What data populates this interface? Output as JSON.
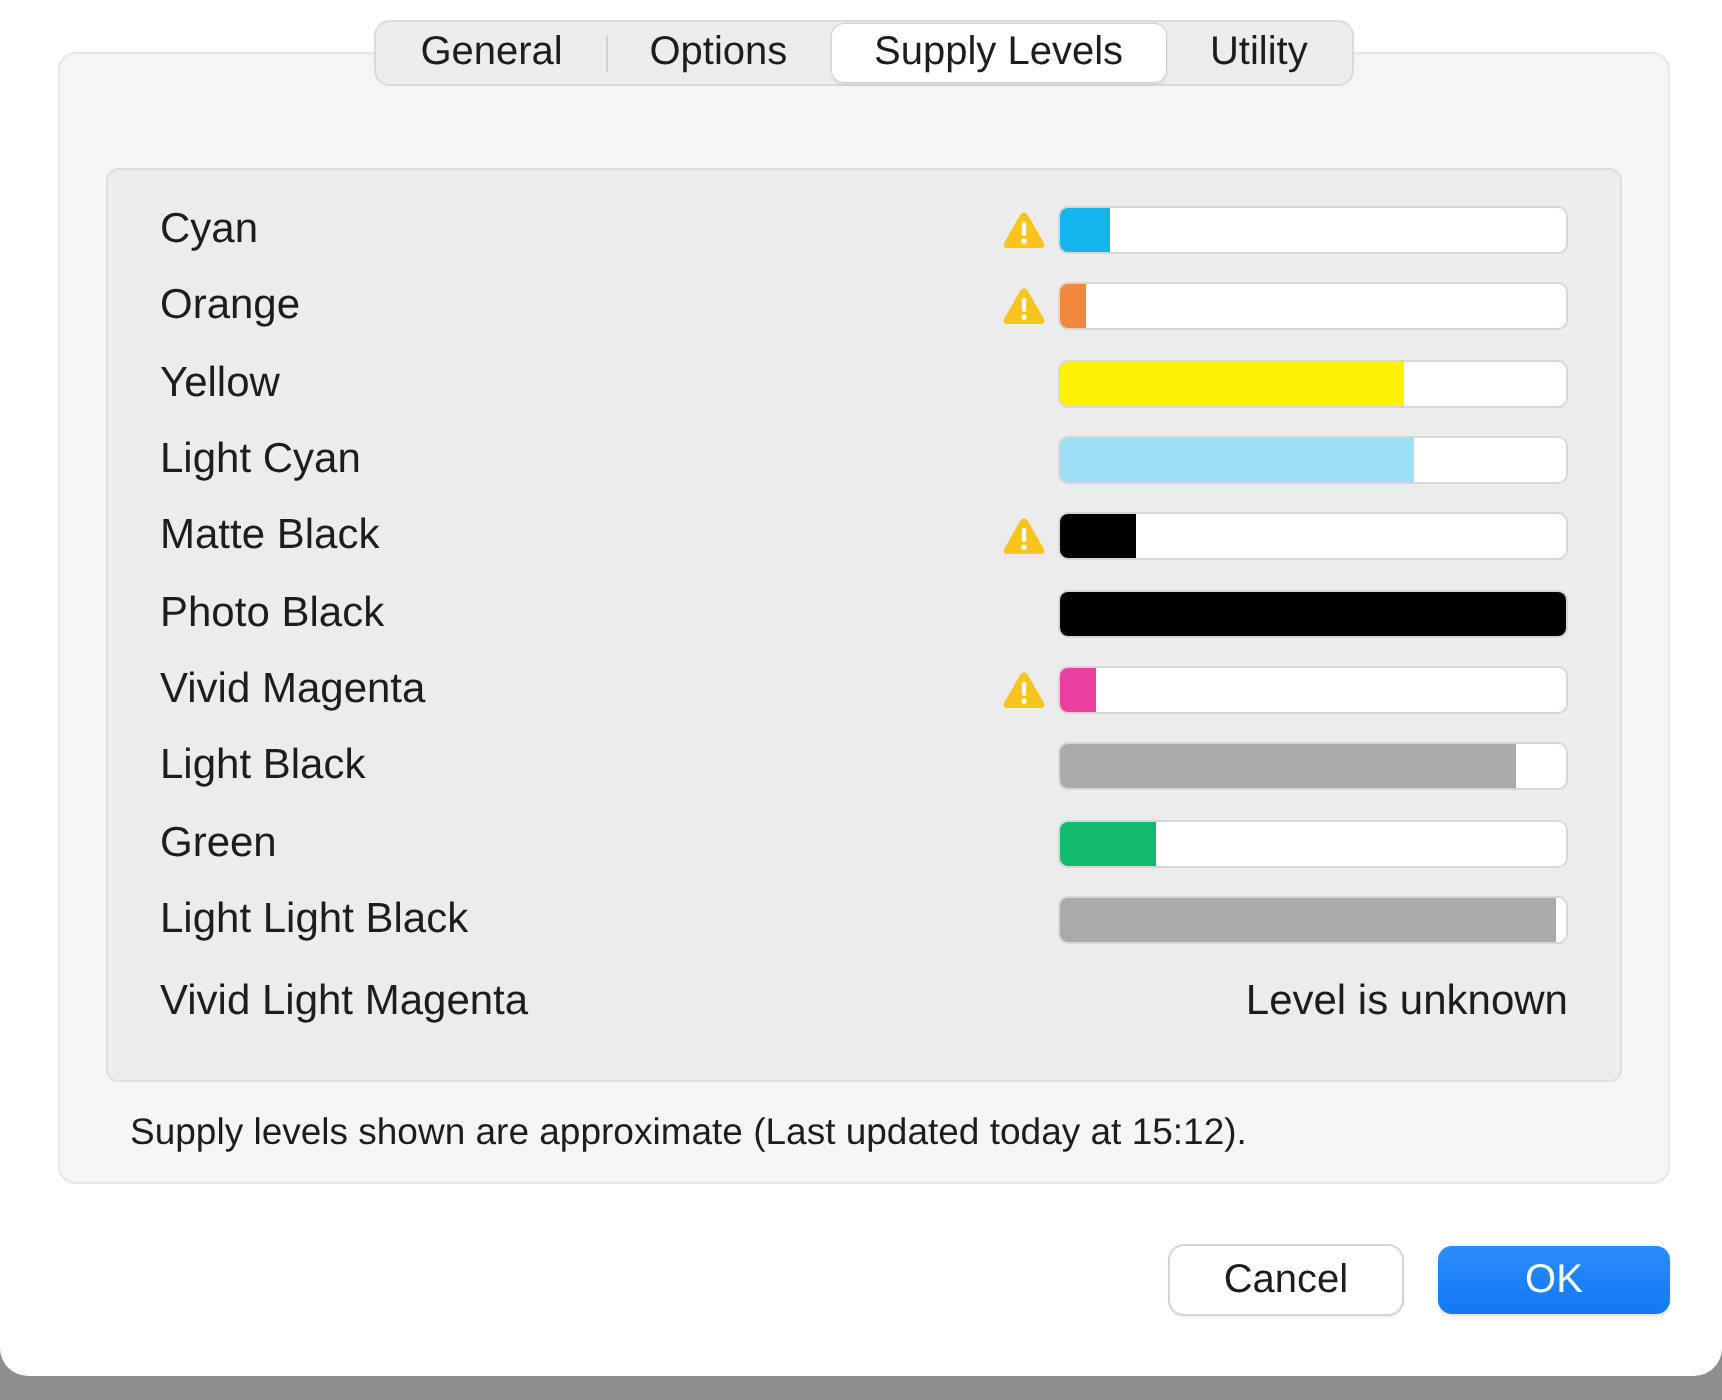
{
  "tabs": [
    {
      "label": "General",
      "selected": false
    },
    {
      "label": "Options",
      "selected": false
    },
    {
      "label": "Supply Levels",
      "selected": true
    },
    {
      "label": "Utility",
      "selected": false
    }
  ],
  "supplies": [
    {
      "name": "Cyan",
      "kind": "bar",
      "warning": true,
      "level": 0.1,
      "color": "#13b5ee"
    },
    {
      "name": "Orange",
      "kind": "bar",
      "warning": true,
      "level": 0.05,
      "color": "#f0893c"
    },
    {
      "name": "Yellow",
      "kind": "bar",
      "warning": false,
      "level": 0.68,
      "color": "#fff200"
    },
    {
      "name": "Light Cyan",
      "kind": "bar",
      "warning": false,
      "level": 0.7,
      "color": "#9ddff7"
    },
    {
      "name": "Matte Black",
      "kind": "bar",
      "warning": true,
      "level": 0.15,
      "color": "#000000"
    },
    {
      "name": "Photo Black",
      "kind": "bar",
      "warning": false,
      "level": 1,
      "color": "#000000"
    },
    {
      "name": "Vivid Magenta",
      "kind": "bar",
      "warning": true,
      "level": 0.07,
      "color": "#ec3ea0"
    },
    {
      "name": "Light Black",
      "kind": "bar",
      "warning": false,
      "level": 0.9,
      "color": "#aaaaaa"
    },
    {
      "name": "Green",
      "kind": "bar",
      "warning": false,
      "level": 0.19,
      "color": "#11ba6c"
    },
    {
      "name": "Light Light Black",
      "kind": "bar",
      "warning": false,
      "level": 0.98,
      "color": "#aaaaaa"
    },
    {
      "name": "Vivid Light Magenta",
      "kind": "unknown",
      "status": "Level is unknown"
    }
  ],
  "footnote": "Supply levels shown are approximate (Last updated today at 15:12).",
  "buttons": [
    {
      "label": "Cancel",
      "kind": "secondary"
    },
    {
      "label": "OK",
      "kind": "primary"
    }
  ]
}
